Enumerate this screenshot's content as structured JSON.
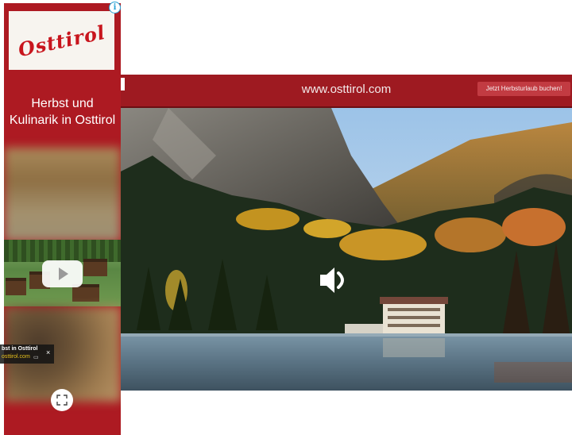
{
  "left_ad": {
    "logo_text": "Osttirol",
    "headline_line1": "Herbst und",
    "headline_line2": "Kulinarik in Osttirol",
    "info_icon": "info-icon",
    "play_icon": "play-icon",
    "expand_icon": "expand-icon"
  },
  "main_ad": {
    "url": "www.osttirol.com",
    "cta_label": "Jetzt Herbsturlaub buchen!",
    "sound_icon": "speaker-icon",
    "caption_title": "bst in Osttirol",
    "caption_url": "osttirol.com",
    "caption_close": "×"
  },
  "colors": {
    "brand_red": "#ad1a22",
    "bar_red": "#9e1a21",
    "caption_yellow": "#e8c21c"
  }
}
